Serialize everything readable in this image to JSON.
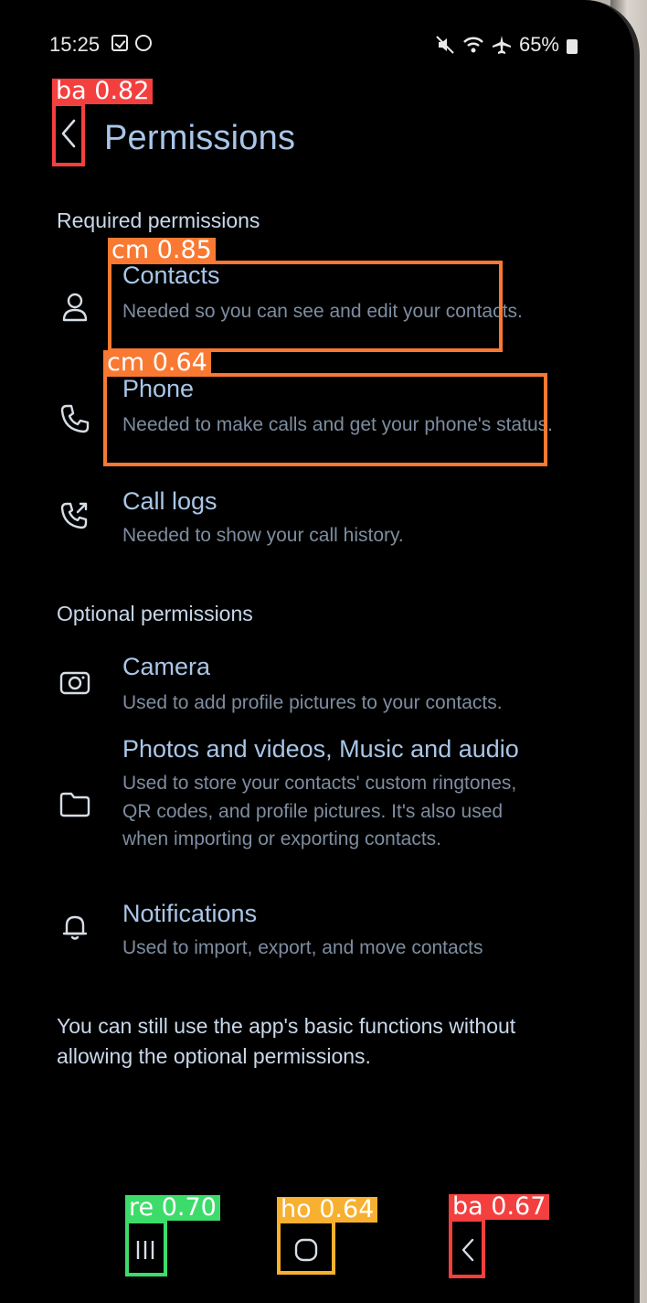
{
  "status_bar": {
    "time": "15:25",
    "battery": "65%",
    "icons": [
      "checkbox-notification-icon",
      "sync-notification-icon",
      "mute-icon",
      "wifi-icon",
      "airplane-icon",
      "battery-icon"
    ]
  },
  "header": {
    "title": "Permissions",
    "back_icon": "back-chevron-icon"
  },
  "required": {
    "title": "Required permissions",
    "items": [
      {
        "icon": "person-icon",
        "title": "Contacts",
        "desc": "Needed so you can see and edit your contacts."
      },
      {
        "icon": "phone-icon",
        "title": "Phone",
        "desc": "Needed to make calls and get your phone's status."
      },
      {
        "icon": "call-log-icon",
        "title": "Call logs",
        "desc": "Needed to show your call history."
      }
    ]
  },
  "optional": {
    "title": "Optional permissions",
    "items": [
      {
        "icon": "camera-icon",
        "title": "Camera",
        "desc": "Used to add profile pictures to your contacts."
      },
      {
        "icon": "folder-icon",
        "title": "Photos and videos, Music and audio",
        "desc": "Used to store your contacts' custom ringtones, QR codes, and profile pictures. It's also used when importing or exporting contacts."
      },
      {
        "icon": "bell-icon",
        "title": "Notifications",
        "desc": "Used to import, export, and move contacts"
      }
    ]
  },
  "footer_note": "You can still use the app's basic functions without allowing the optional permissions.",
  "nav_bar": {
    "recents_icon": "recents-icon",
    "home_icon": "home-icon",
    "back_icon": "nav-back-icon"
  },
  "detections": [
    {
      "label": "ba 0.82",
      "color": "#f43f3f"
    },
    {
      "label": "cm 0.85",
      "color": "#f97932"
    },
    {
      "label": "cm 0.64",
      "color": "#f97932"
    },
    {
      "label": "re 0.70",
      "color": "#3ddc6a"
    },
    {
      "label": "ho 0.64",
      "color": "#f8b030"
    },
    {
      "label": "ba 0.67",
      "color": "#f43f3f"
    }
  ]
}
